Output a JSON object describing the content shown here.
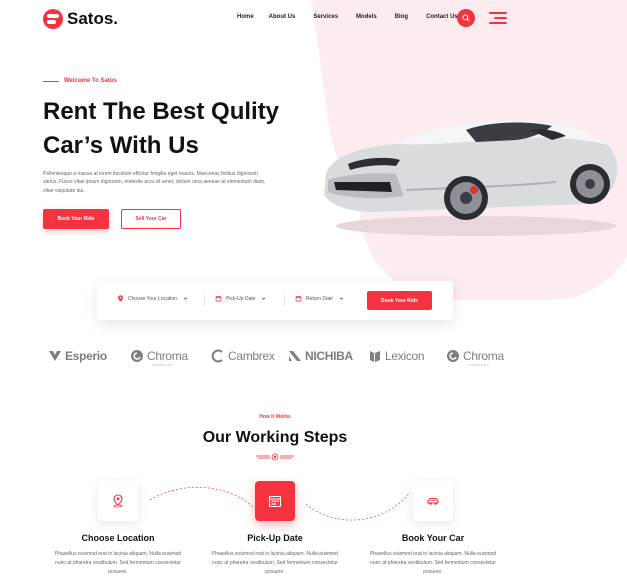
{
  "brand": {
    "name": "Satos."
  },
  "nav": {
    "items": [
      "Home",
      "About Us",
      "Services",
      "Models",
      "Blog",
      "Contact Us"
    ]
  },
  "hero": {
    "eyebrow": "Welcome To Satos",
    "title_line1": "Rent The Best Qulity",
    "title_line2": "Car’s With Us",
    "description": "Pellentesque a massa at lorem tincidunt efficitur fringilla eget mauris. Maecenas finibus dignissim varius. Fusce vitae ipsum dignissim, molestie arcu sit amet, dictum urna aenean at elementum diam, vitae vulputate dui.",
    "primary_button": "Book Your Ride",
    "secondary_button": "Sell Your Car"
  },
  "booking": {
    "location": "Choose Your Location",
    "pickup": "Pick-Up Date",
    "return": "Return Date",
    "button": "Book Your Ride"
  },
  "brands": [
    {
      "name": "Esperio",
      "icon": "esperio-logo-icon"
    },
    {
      "name": "Chroma",
      "sub": "COMPANY",
      "icon": "chroma-logo-icon"
    },
    {
      "name": "Cambrex",
      "icon": "cambrex-logo-icon"
    },
    {
      "name": "NICHIBA",
      "icon": "nichiba-logo-icon"
    },
    {
      "name": "Lexicon",
      "icon": "lexicon-logo-icon"
    },
    {
      "name": "Chroma",
      "sub": "COMPANY",
      "icon": "chroma-logo-icon"
    }
  ],
  "how": {
    "label": "How It Works",
    "title": "Our Working Steps",
    "steps": [
      {
        "title": "Choose Location",
        "text": "Phasellus euismod erat in lacinia aliquam. Nulla euismod nunc at pharetra vestibulum. Sed fermentum consectetur posuere.",
        "icon": "location-pin-icon"
      },
      {
        "title": "Pick-Up Date",
        "text": "Phasellus euismod erat in lacinia aliquam. Nulla euismod nunc at pharetra vestibulum. Sed fermentum consectetur posuere.",
        "icon": "calendar-icon"
      },
      {
        "title": "Book Your Car",
        "text": "Phasellus euismod erat in lacinia aliquam. Nulla euismod nunc at pharetra vestibulum. Sed fermentum consectetur posuere.",
        "icon": "car-icon"
      }
    ]
  },
  "colors": {
    "accent": "#f4333f",
    "blob": "#fdecef",
    "text": "#111111"
  }
}
